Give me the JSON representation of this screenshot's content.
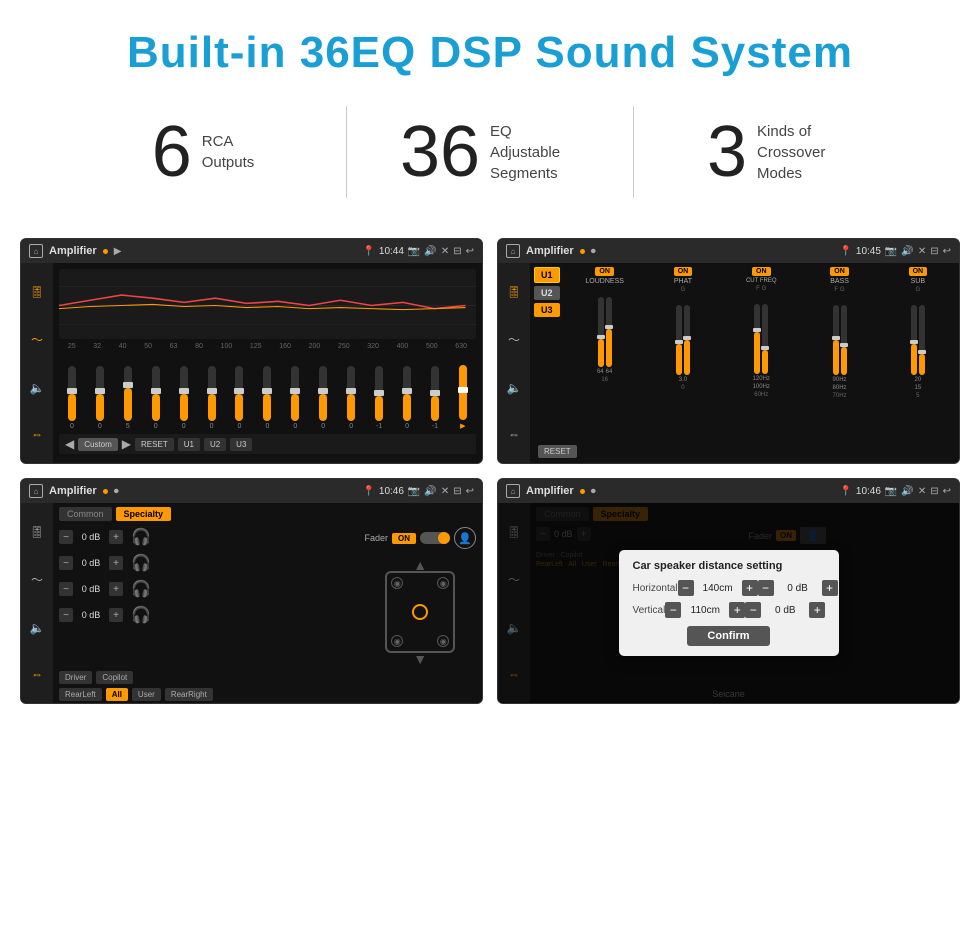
{
  "header": {
    "title": "Built-in 36EQ DSP Sound System",
    "color": "#1a9fd4"
  },
  "stats": [
    {
      "number": "6",
      "text_line1": "RCA",
      "text_line2": "Outputs"
    },
    {
      "number": "36",
      "text_line1": "EQ Adjustable",
      "text_line2": "Segments"
    },
    {
      "number": "3",
      "text_line1": "Kinds of",
      "text_line2": "Crossover Modes"
    }
  ],
  "screens": [
    {
      "id": "screen1",
      "topbar": {
        "app": "Amplifier",
        "time": "10:44"
      },
      "type": "eq",
      "freq_labels": [
        "25",
        "32",
        "40",
        "50",
        "63",
        "80",
        "100",
        "125",
        "160",
        "200",
        "250",
        "320",
        "400",
        "500",
        "630"
      ],
      "eq_values": [
        0,
        0,
        5,
        0,
        0,
        0,
        0,
        0,
        0,
        0,
        0,
        -1,
        0,
        -1
      ],
      "bottom_buttons": [
        "Custom",
        "RESET",
        "U1",
        "U2",
        "U3"
      ]
    },
    {
      "id": "screen2",
      "topbar": {
        "app": "Amplifier",
        "time": "10:45"
      },
      "type": "crossover",
      "u_buttons": [
        "U1",
        "U2",
        "U3"
      ],
      "channels": [
        "LOUDNESS",
        "PHAT",
        "CUT FREQ",
        "BASS",
        "SUB"
      ],
      "channel_on": [
        true,
        true,
        true,
        true,
        true
      ]
    },
    {
      "id": "screen3",
      "topbar": {
        "app": "Amplifier",
        "time": "10:46"
      },
      "type": "fader",
      "tabs": [
        "Common",
        "Specialty"
      ],
      "active_tab": 1,
      "fader_label": "Fader",
      "fader_on": "ON",
      "vol_rows": [
        {
          "val": "0 dB"
        },
        {
          "val": "0 dB"
        },
        {
          "val": "0 dB"
        },
        {
          "val": "0 dB"
        }
      ],
      "bottom_buttons": [
        "Driver",
        "RearLeft",
        "All",
        "User",
        "Copilot",
        "RearRight"
      ]
    },
    {
      "id": "screen4",
      "topbar": {
        "app": "Amplifier",
        "time": "10:46"
      },
      "type": "dialog",
      "dialog": {
        "title": "Car speaker distance setting",
        "horizontal_label": "Horizontal",
        "horizontal_val": "140cm",
        "vertical_label": "Vertical",
        "vertical_val": "110cm",
        "confirm_label": "Confirm",
        "db_vals": [
          "0 dB",
          "0 dB"
        ]
      },
      "tabs": [
        "Common",
        "Specialty"
      ],
      "fader_label": "Fader",
      "fader_on": "ON",
      "bottom_buttons": [
        "Driver",
        "RearLeft",
        "All",
        "User",
        "Copilot",
        "RearRight"
      ]
    }
  ],
  "watermark": "Seicane"
}
